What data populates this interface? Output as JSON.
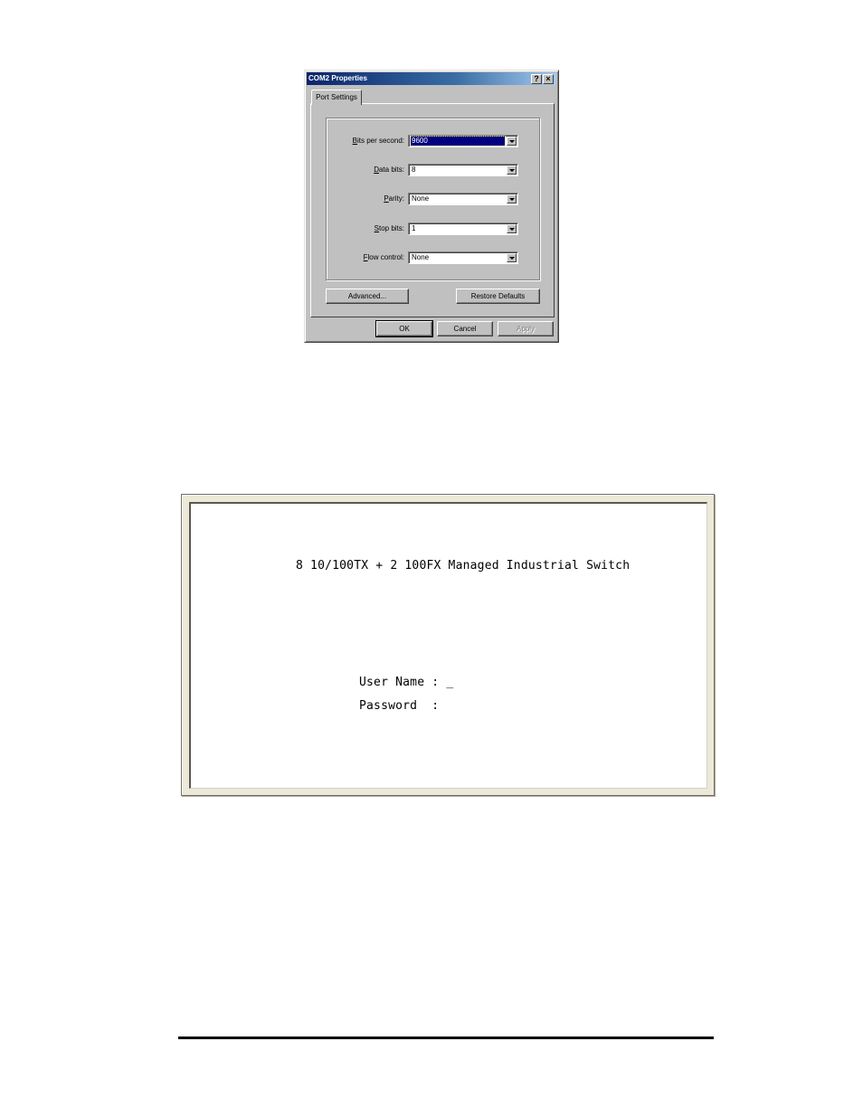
{
  "dialog": {
    "title": "COM2 Properties",
    "help_button": "?",
    "close_button": "×",
    "tabs": [
      {
        "label": "Port Settings",
        "active": true
      }
    ],
    "fields": [
      {
        "label": "Bits per second:",
        "value": "9600",
        "selected": true
      },
      {
        "label": "Data bits:",
        "value": "8"
      },
      {
        "label": "Parity:",
        "value": "None"
      },
      {
        "label": "Stop bits:",
        "value": "1"
      },
      {
        "label": "Flow control:",
        "value": "None"
      }
    ],
    "advanced_button": "Advanced...",
    "restore_button": "Restore Defaults",
    "ok_button": "OK",
    "cancel_button": "Cancel",
    "apply_button": "Apply"
  },
  "terminal": {
    "banner": "8 10/100TX + 2 100FX Managed Industrial Switch",
    "username_prompt": "User Name : _",
    "password_prompt": "Password  :"
  }
}
